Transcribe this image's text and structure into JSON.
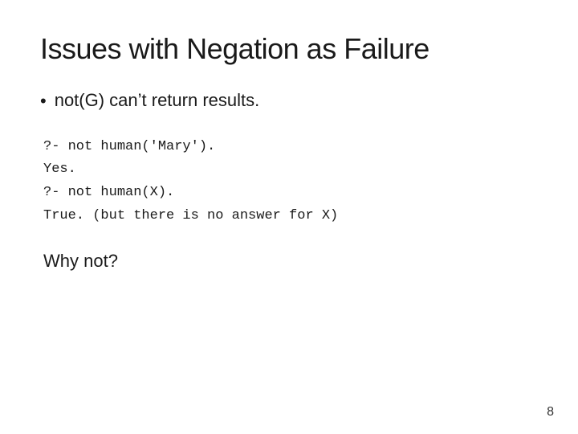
{
  "slide": {
    "title": "Issues with Negation as Failure",
    "bullet": {
      "text": "not(G) can’t return results."
    },
    "code": {
      "lines": [
        "?- not human('Mary').",
        "Yes.",
        "?- not human(X).",
        "True. (but there is no answer for X)"
      ]
    },
    "why_not": "Why not?",
    "page_number": "8"
  }
}
